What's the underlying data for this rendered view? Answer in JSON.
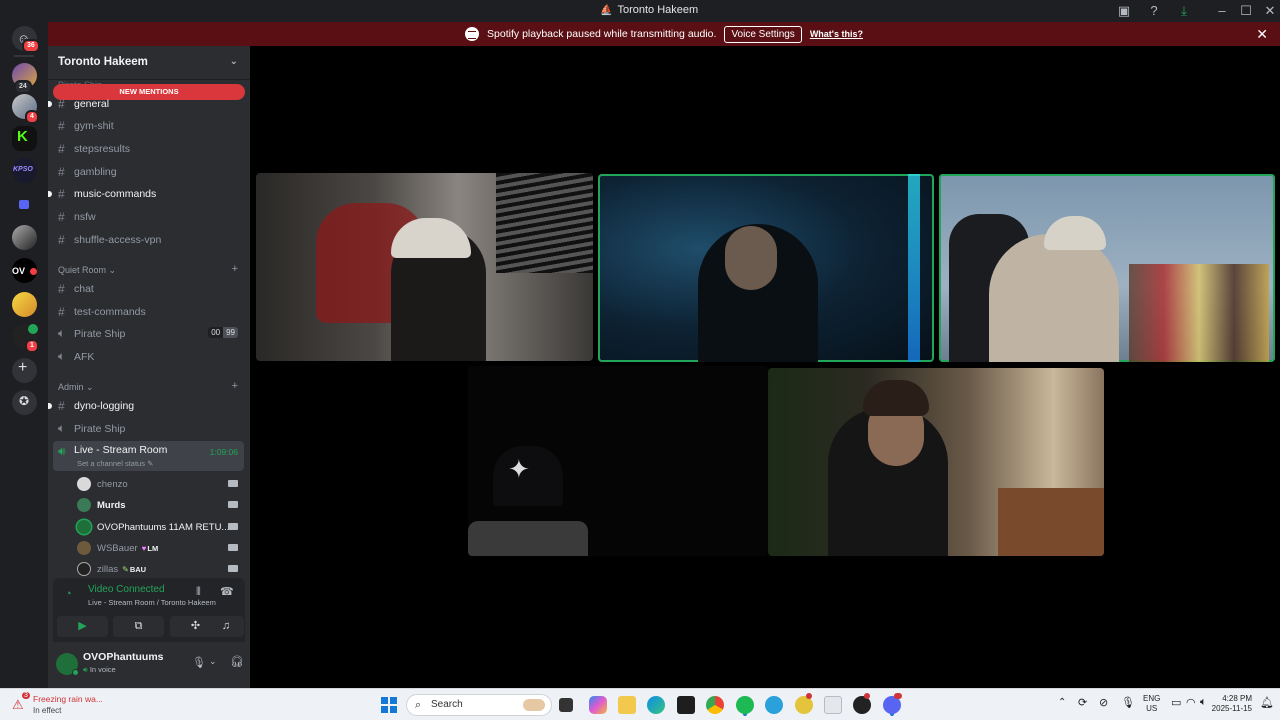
{
  "window": {
    "title": "Toronto Hakeem"
  },
  "notice": {
    "text": "Spotify playback paused while transmitting audio.",
    "button": "Voice Settings",
    "link": "What's this?"
  },
  "rail": {
    "home_badge": "36",
    "badges": [
      "24",
      "4",
      "1"
    ]
  },
  "server": {
    "name": "Toronto Hakeem",
    "new_mentions": "NEW MENTIONS",
    "faded_category": "Pirate Ship"
  },
  "channels": [
    {
      "name": "general",
      "unread": true
    },
    {
      "name": "gym-shit",
      "unread": false
    },
    {
      "name": "stepsresults",
      "unread": false
    },
    {
      "name": "gambling",
      "unread": false
    },
    {
      "name": "music-commands",
      "unread": true
    },
    {
      "name": "nsfw",
      "unread": false
    },
    {
      "name": "shuffle-access-vpn",
      "unread": false
    }
  ],
  "categories": {
    "quiet_room": "Quiet Room",
    "admin": "Admin"
  },
  "quiet_room_channels": {
    "chat": "chat",
    "test_commands": "test-commands",
    "pirate_ship": "Pirate Ship",
    "pirate_ship_counts": [
      "00",
      "99"
    ],
    "afk": "AFK"
  },
  "admin_channels": {
    "dyno_logging": "dyno-logging",
    "pirate_ship": "Pirate Ship",
    "live_stream": "Live - Stream Room",
    "live_timer": "1:09:06",
    "live_status": "Set a channel status"
  },
  "voice_users": [
    {
      "name": "chenzo",
      "tag": "",
      "color": "#d9d9d9"
    },
    {
      "name": "Murds",
      "tag": "",
      "color": "#3b7a57"
    },
    {
      "name": "OVOPhantuums 11AM RETU...",
      "tag": "",
      "color": "#1f6f3a"
    },
    {
      "name": "WSBauer",
      "tag": "LM",
      "color": "#6d5a3c"
    },
    {
      "name": "zillas",
      "tag": "BAU",
      "color": "#222"
    }
  ],
  "rtc": {
    "status": "Video Connected",
    "channel": "Live - Stream Room / Toronto Hakeem"
  },
  "user": {
    "name": "OVOPhantuums",
    "status": "In voice"
  },
  "taskbar": {
    "weather_title": "Freezing rain wa...",
    "weather_sub": "In effect",
    "weather_badge": "3",
    "search": "Search",
    "lang": "ENG",
    "region": "US",
    "time": "4:28 PM",
    "date": "2025-11-15"
  }
}
